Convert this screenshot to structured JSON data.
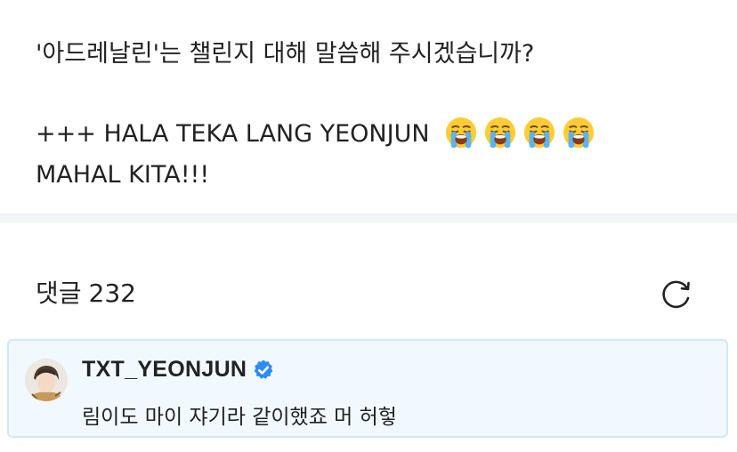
{
  "post": {
    "line1": "'아드레날린'는 챌린지 대해 말씀해 주시겠습니까?",
    "line2": "+++ HALA TEKA LANG YEONJUN",
    "emojis": [
      "loudly-crying-face-emoji",
      "loudly-crying-face-emoji",
      "loudly-crying-face-emoji",
      "loudly-crying-face-emoji"
    ],
    "line3": "MAHAL KITA!!!"
  },
  "comments": {
    "label": "댓글",
    "count": "232"
  },
  "pinned_comment": {
    "author": "TXT_YEONJUN",
    "text": "림이도 마이 쟈기라 같이했죠 머 허헣",
    "icons": {
      "avatar": "profile-photo",
      "badge": "verified-badge-icon"
    }
  },
  "colors": {
    "verified_badge": "#2f8cf5",
    "pinned_background": "#f1f9ff",
    "pinned_border": "#cfe8fb",
    "divider": "#f3f4f7",
    "text": "#222222"
  }
}
